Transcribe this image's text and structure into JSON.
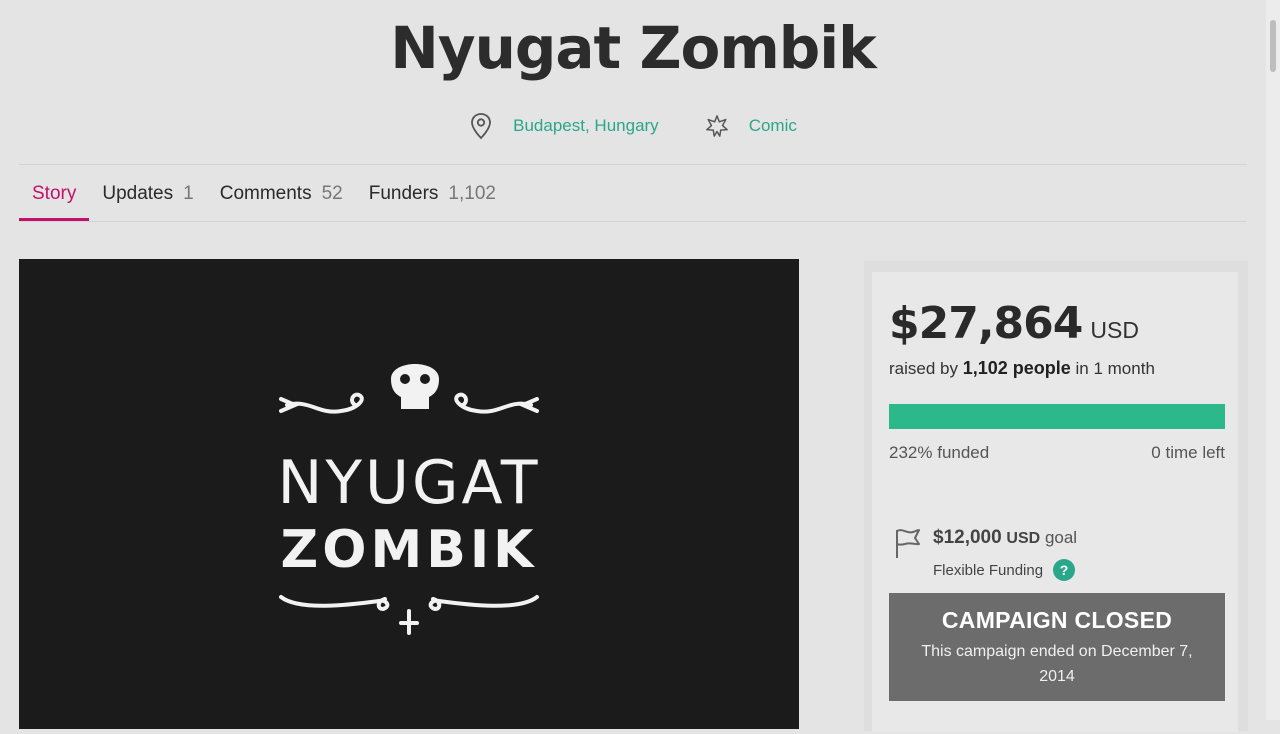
{
  "page": {
    "title": "Nyugat Zombik"
  },
  "meta": {
    "location": "Budapest, Hungary",
    "category": "Comic",
    "icons": [
      "location-pin-icon",
      "category-star-icon"
    ]
  },
  "tabs": [
    {
      "label": "Story",
      "count": ""
    },
    {
      "label": "Updates",
      "count": "1"
    },
    {
      "label": "Comments",
      "count": "52"
    },
    {
      "label": "Funders",
      "count": "1,102"
    }
  ],
  "hero": {
    "logo_line1": "NYUGAT",
    "logo_line2": "ZOMBIK"
  },
  "campaign": {
    "raised_amount": "$27,864",
    "currency": "USD",
    "raised_by_prefix": "raised by",
    "people": "1,102 people",
    "duration": "in 1 month",
    "progress_fraction": 1.0,
    "funded_percent": "232%",
    "funded_label": "funded",
    "time_left": "0 time left",
    "goal_amount": "$12,000",
    "goal_currency": "USD",
    "goal_label": "goal",
    "funding_type": "Flexible Funding",
    "help": "?",
    "closed_title": "CAMPAIGN CLOSED",
    "closed_text": "This campaign ended on December 7, 2014"
  },
  "colors": {
    "accent_teal": "#2aa78b",
    "tab_active": "#c2116a",
    "progress": "#2bb98c",
    "closed_bg": "#6c6c6c"
  }
}
